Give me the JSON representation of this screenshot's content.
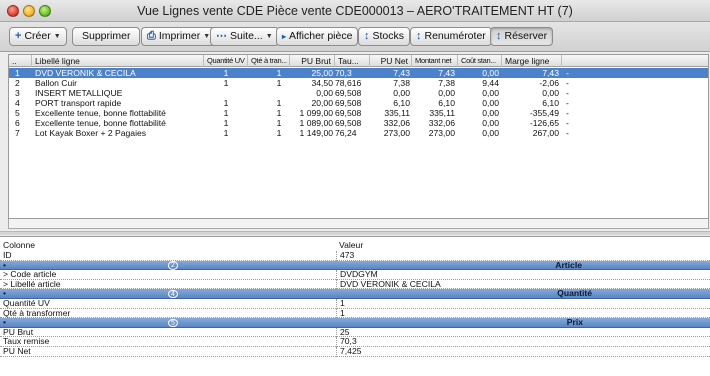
{
  "window": {
    "title": "Vue Lignes vente CDE Pièce vente CDE000013 – AERO'TRAITEMENT HT (7)"
  },
  "toolbar": {
    "creer": "Créer",
    "supprimer": "Supprimer",
    "imprimer": "Imprimer",
    "suite": "Suite...",
    "afficher": "Afficher pièce",
    "stocks": "Stocks",
    "renumeroter": "Renuméroter",
    "reserver": "Réserver"
  },
  "grid": {
    "headers": {
      "num": "..",
      "libelle": "Libellé ligne",
      "quantite": "Quantité UV",
      "qte_tran": "Qté à tran...",
      "pu_brut": "PU Brut",
      "tau": "Tau...",
      "pu_net": "PU Net",
      "montant": "Montant net",
      "cout": "Coût stan...",
      "marge": "Marge ligne"
    },
    "rows": [
      {
        "n": "1",
        "lib": "DVD VERONIK & CECILA",
        "q": "1",
        "qt": "1",
        "pub": "25,00",
        "tau": "70,3",
        "pun": "7,43",
        "mont": "7,43",
        "cout": "0,00",
        "marge": "7,43",
        "d": "-"
      },
      {
        "n": "2",
        "lib": "Ballon Cuir",
        "q": "1",
        "qt": "1",
        "pub": "34,50",
        "tau": "78,616",
        "pun": "7,38",
        "mont": "7,38",
        "cout": "9,44",
        "marge": "-2,06",
        "d": "-"
      },
      {
        "n": "3",
        "lib": "INSERT METALLIQUE",
        "q": "",
        "qt": "",
        "pub": "0,00",
        "tau": "69,508",
        "pun": "0,00",
        "mont": "0,00",
        "cout": "0,00",
        "marge": "0,00",
        "d": "-"
      },
      {
        "n": "4",
        "lib": "PORT transport rapide",
        "q": "1",
        "qt": "1",
        "pub": "20,00",
        "tau": "69,508",
        "pun": "6,10",
        "mont": "6,10",
        "cout": "0,00",
        "marge": "6,10",
        "d": "-"
      },
      {
        "n": "5",
        "lib": "Excellente tenue, bonne flottabilité",
        "q": "1",
        "qt": "1",
        "pub": "1 099,00",
        "tau": "69,508",
        "pun": "335,11",
        "mont": "335,11",
        "cout": "0,00",
        "marge": "-355,49",
        "d": "-"
      },
      {
        "n": "6",
        "lib": "Excellente tenue, bonne flottabilité",
        "q": "1",
        "qt": "1",
        "pub": "1 089,00",
        "tau": "69,508",
        "pun": "332,06",
        "mont": "332,06",
        "cout": "0,00",
        "marge": "-126,65",
        "d": "-"
      },
      {
        "n": "7",
        "lib": "Lot Kayak Boxer + 2 Pagaies",
        "q": "1",
        "qt": "1",
        "pub": "1 149,00",
        "tau": "76,24",
        "pun": "273,00",
        "mont": "273,00",
        "cout": "0,00",
        "marge": "267,00",
        "d": "-"
      }
    ]
  },
  "detail": {
    "col_label": "Colonne",
    "val_label": "Valeur",
    "rows": [
      {
        "k": "ID",
        "v": "473"
      },
      {
        "group": true,
        "num": "2",
        "title": "Article"
      },
      {
        "k": "> Code article",
        "v": "DVDGYM"
      },
      {
        "k": "> Libellé article",
        "v": "DVD VERONIK & CECILA"
      },
      {
        "group": true,
        "num": "4",
        "title": "Quantité"
      },
      {
        "k": "Quantité UV",
        "v": "1"
      },
      {
        "k": "Qté à transformer",
        "v": "1"
      },
      {
        "group": true,
        "num": "5",
        "title": "Prix"
      },
      {
        "k": "PU Brut",
        "v": "25"
      },
      {
        "k": "Taux remise",
        "v": "70,3"
      },
      {
        "k": "PU Net",
        "v": "7,425"
      }
    ]
  }
}
